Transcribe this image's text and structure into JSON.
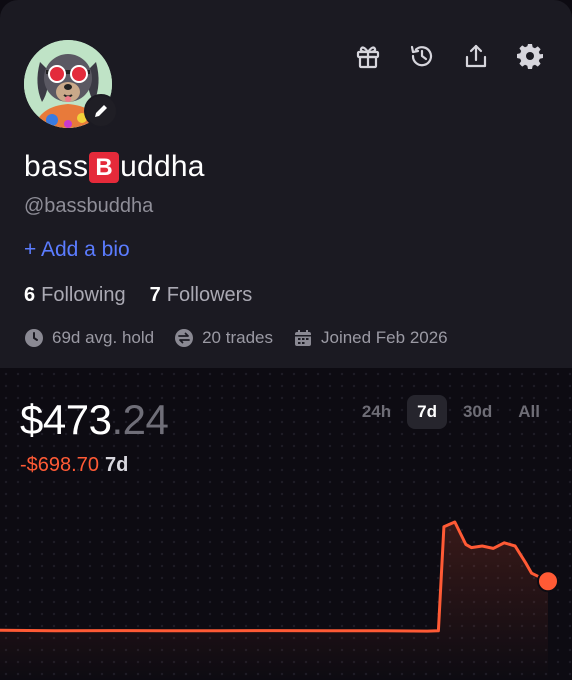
{
  "profile": {
    "name_prefix": "bass",
    "name_badge": "B",
    "name_suffix": "uddha",
    "handle": "@bassbuddha",
    "bio_cta": "+ Add a bio",
    "following_count": "6",
    "following_label": "Following",
    "followers_count": "7",
    "followers_label": "Followers",
    "stats": {
      "avg_hold": "69d avg. hold",
      "trades": "20 trades",
      "joined": "Joined Feb 2026"
    }
  },
  "header_icons": [
    "gift-icon",
    "history-icon",
    "share-icon",
    "settings-icon"
  ],
  "portfolio": {
    "value_main": "$473",
    "value_cents": ".24",
    "change_value": "-$698.70",
    "change_period": "7d",
    "ranges": [
      "24h",
      "7d",
      "30d",
      "All"
    ],
    "active_range": "7d"
  },
  "chart_data": {
    "type": "line",
    "x": [
      0,
      0.1,
      0.2,
      0.3,
      0.4,
      0.5,
      0.6,
      0.7,
      0.78,
      0.8,
      0.81,
      0.83,
      0.85,
      0.86,
      0.88,
      0.9,
      0.92,
      0.94,
      0.96,
      0.97,
      1.0
    ],
    "values": [
      473,
      470,
      471,
      470,
      470,
      471,
      470,
      470,
      468,
      470,
      1120,
      1150,
      1010,
      990,
      1000,
      985,
      1020,
      1000,
      890,
      830,
      780
    ],
    "ylim": [
      300,
      1300
    ],
    "color": "#ff5a35"
  },
  "colors": {
    "accent_blue": "#5b7cff",
    "negative": "#ff5a35",
    "card_bg": "#1b1a22",
    "page_bg": "#0d0b12"
  }
}
